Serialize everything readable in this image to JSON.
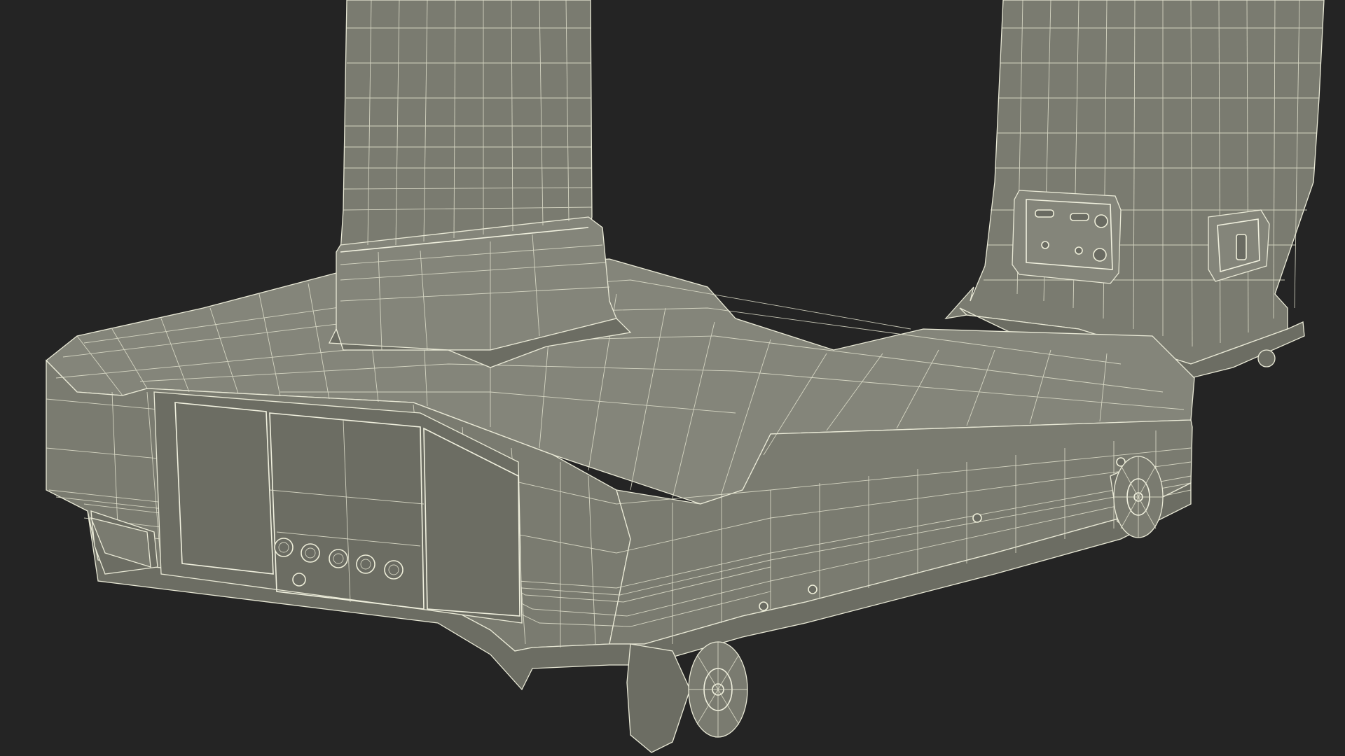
{
  "scene": {
    "background_color": "#242424",
    "mesh_fill_color": "#7a7b70",
    "wire_color": "#e9e9d6",
    "render_style": "wireframe-over-shaded"
  }
}
